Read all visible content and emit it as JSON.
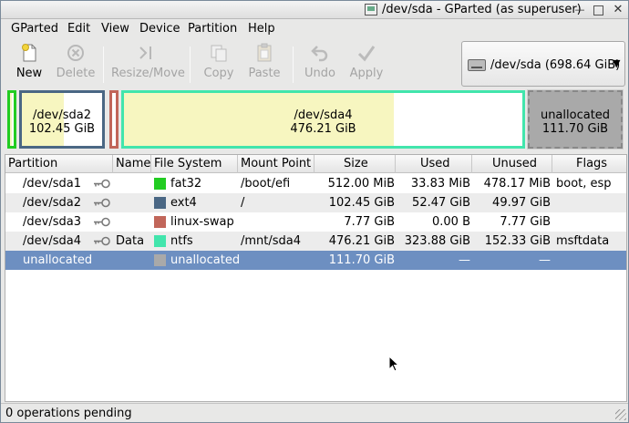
{
  "window": {
    "title": "/dev/sda - GParted (as superuser)"
  },
  "menubar": {
    "items": [
      "GParted",
      "Edit",
      "View",
      "Device",
      "Partition",
      "Help"
    ]
  },
  "toolbar": {
    "new": "New",
    "delete": "Delete",
    "resize": "Resize/Move",
    "copy": "Copy",
    "paste": "Paste",
    "undo": "Undo",
    "apply": "Apply"
  },
  "device_selector": {
    "label": "/dev/sda   (698.64 GiB)"
  },
  "disk_map": {
    "sda2": {
      "name": "/dev/sda2",
      "size": "102.45 GiB"
    },
    "sda4": {
      "name": "/dev/sda4",
      "size": "476.21 GiB"
    },
    "unallocated": {
      "name": "unallocated",
      "size": "111.70 GiB"
    }
  },
  "table": {
    "columns": [
      "Partition",
      "Name",
      "File System",
      "Mount Point",
      "Size",
      "Used",
      "Unused",
      "Flags"
    ],
    "rows": [
      {
        "partition": "/dev/sda1",
        "name": "",
        "fs": "fat32",
        "fs_color": "#22cc22",
        "mount": "/boot/efi",
        "size": "512.00 MiB",
        "used": "33.83 MiB",
        "unused": "478.17 MiB",
        "flags": "boot, esp"
      },
      {
        "partition": "/dev/sda2",
        "name": "",
        "fs": "ext4",
        "fs_color": "#4a6784",
        "mount": "/",
        "size": "102.45 GiB",
        "used": "52.47 GiB",
        "unused": "49.97 GiB",
        "flags": ""
      },
      {
        "partition": "/dev/sda3",
        "name": "",
        "fs": "linux-swap",
        "fs_color": "#c1665a",
        "mount": "",
        "size": "7.77 GiB",
        "used": "0.00 B",
        "unused": "7.77 GiB",
        "flags": ""
      },
      {
        "partition": "/dev/sda4",
        "name": "Data",
        "fs": "ntfs",
        "fs_color": "#42e5ac",
        "mount": "/mnt/sda4",
        "size": "476.21 GiB",
        "used": "323.88 GiB",
        "unused": "152.33 GiB",
        "flags": "msftdata"
      },
      {
        "partition": "unallocated",
        "name": "",
        "fs": "unallocated",
        "fs_color": "#a9a9a9",
        "mount": "",
        "size": "111.70 GiB",
        "used": "—",
        "unused": "—",
        "flags": ""
      }
    ]
  },
  "status": {
    "text": "0 operations pending"
  },
  "colors": {
    "selection": "#6d8fc1",
    "used_fill": "#f7f6c0"
  }
}
